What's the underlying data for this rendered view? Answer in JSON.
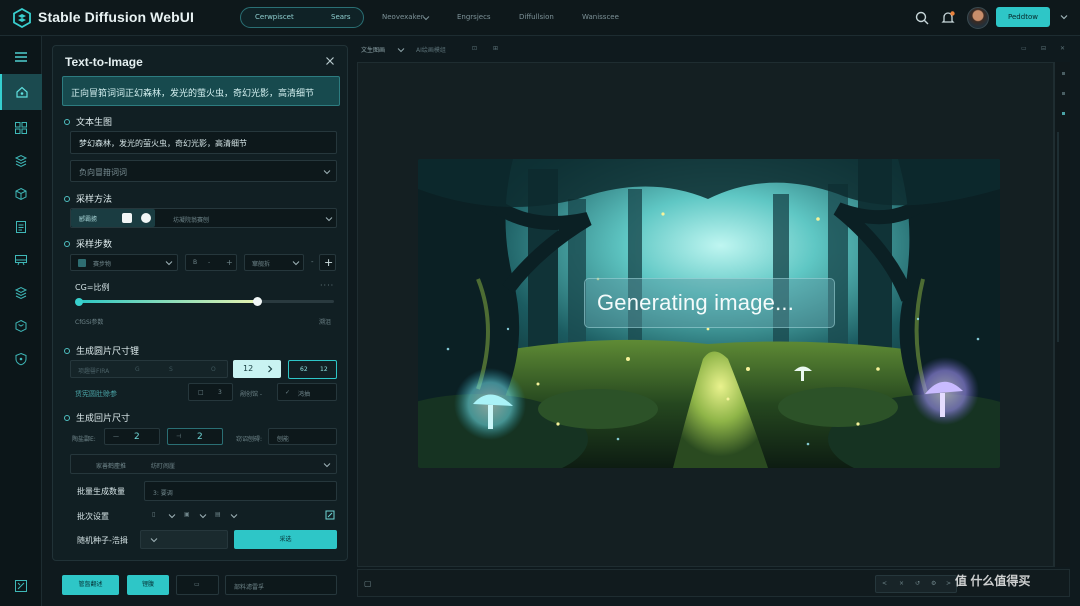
{
  "app": {
    "title": "Stable Diffusion WebUI"
  },
  "topnav": {
    "pill_left": "Cerwpiscet",
    "pill_right": "Sears",
    "links": [
      "Neovexaker",
      "Engrsjecs",
      "Diffullsion",
      "Wanisscee"
    ],
    "primary_button": "Peddtow"
  },
  "panel": {
    "title": "Text-to-Image",
    "prompt_banner": "正向冒筘词词正幻森林，发光的萤火虫，奇幻光影，高清细节",
    "text_to_image": {
      "heading": "文本生图",
      "prompt_value": "梦幻森林，发光的萤火虫，奇幻光影，高清细节",
      "negative_placeholder": "负向冒箝词词"
    },
    "sampler": {
      "heading": "采样方法",
      "selected": "郾霸掳",
      "option_hint": "坊凝院翁赛刨"
    },
    "steps": {
      "heading": "采样步数",
      "field1": "赛步物",
      "field2": "B",
      "field3": "窜舰拆",
      "cfg_label": "CG=比例",
      "cfg_sub": "CfGSi参数",
      "cfg_right": "溯沮",
      "cfg_value": 0.7
    },
    "size": {
      "heading": "生成圆片尺寸锂",
      "dim_placeholder": "项趣罄FIRA",
      "dim_value": "12",
      "dim_alt": "62",
      "dim_alt2": "12",
      "advanced_label": "赁宪圆肚赊参",
      "adv_val1": "3",
      "adv_mid": "剐创馆 -",
      "adv_check": "鸿抽"
    },
    "output": {
      "heading": "生成回片尺寸",
      "row_label": "陶盐酃E:",
      "w_value": "2",
      "h_value": "2",
      "right_label": "窃诏刨碍:",
      "right_field": "刨能",
      "select_label": "家善鹤麈推",
      "select_value": "纺盯闹崖"
    },
    "batch": {
      "count_label": "批量生成数量",
      "count_value": "3: 要调",
      "settings_label": "批次设置",
      "seed_label": "随机种子-浩揖",
      "seed_button": "采选"
    }
  },
  "bottom": {
    "btn1": "管盔翻述",
    "btn2": "锂腹",
    "field": "部料滤雷孚"
  },
  "canvas": {
    "tab1": "文生图画",
    "tab2": "AI绘画模组",
    "status": "Generating image..."
  },
  "watermark": "值 什么值得买",
  "colors": {
    "accent": "#2ec6c7",
    "bg": "#0f1a1e"
  }
}
